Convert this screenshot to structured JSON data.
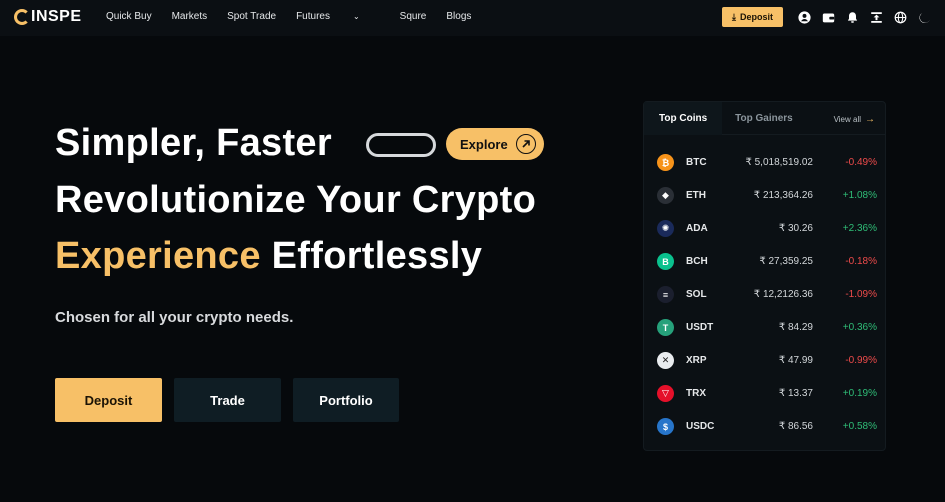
{
  "nav": {
    "logo": "INSPE",
    "menu": [
      "Quick Buy",
      "Markets",
      "Spot Trade",
      "Futures",
      "Squre",
      "Blogs"
    ],
    "deposit_label": "Deposit"
  },
  "hero": {
    "line1": "Simpler, Faster",
    "line2": "Revolutionize Your Crypto",
    "line3_accent": "Experience",
    "line3_rest": " Effortlessly",
    "explore_label": "Explore",
    "subtitle": "Chosen for all your crypto needs.",
    "buttons": {
      "deposit": "Deposit",
      "trade": "Trade",
      "portfolio": "Portfolio"
    }
  },
  "panel": {
    "tabs": [
      "Top Coins",
      "Top Gainers"
    ],
    "view_all": "View all",
    "coins": [
      {
        "symbol": "BTC",
        "price": "₹ 5,018,519.02",
        "change": "-0.49%",
        "dir": "down",
        "color": "#f7931a",
        "glyph": "₿"
      },
      {
        "symbol": "ETH",
        "price": "₹ 213,364.26",
        "change": "+1.08%",
        "dir": "up",
        "color": "#2a2f36",
        "glyph": "◆"
      },
      {
        "symbol": "ADA",
        "price": "₹ 30.26",
        "change": "+2.36%",
        "dir": "up",
        "color": "#1a2a5a",
        "glyph": "✺"
      },
      {
        "symbol": "BCH",
        "price": "₹ 27,359.25",
        "change": "-0.18%",
        "dir": "down",
        "color": "#0ac18e",
        "glyph": "B"
      },
      {
        "symbol": "SOL",
        "price": "₹ 12,2126.36",
        "change": "-1.09%",
        "dir": "down",
        "color": "#1b1f2e",
        "glyph": "≡"
      },
      {
        "symbol": "USDT",
        "price": "₹ 84.29",
        "change": "+0.36%",
        "dir": "up",
        "color": "#26a17b",
        "glyph": "T"
      },
      {
        "symbol": "XRP",
        "price": "₹ 47.99",
        "change": "-0.99%",
        "dir": "down",
        "color": "#e9ecef",
        "glyph": "✕"
      },
      {
        "symbol": "TRX",
        "price": "₹ 13.37",
        "change": "+0.19%",
        "dir": "up",
        "color": "#e5102a",
        "glyph": "▽"
      },
      {
        "symbol": "USDC",
        "price": "₹ 86.56",
        "change": "+0.58%",
        "dir": "up",
        "color": "#2775ca",
        "glyph": "$"
      }
    ]
  },
  "colors": {
    "accent": "#f7c067",
    "up": "#2fbd77",
    "down": "#ee4b4b"
  }
}
